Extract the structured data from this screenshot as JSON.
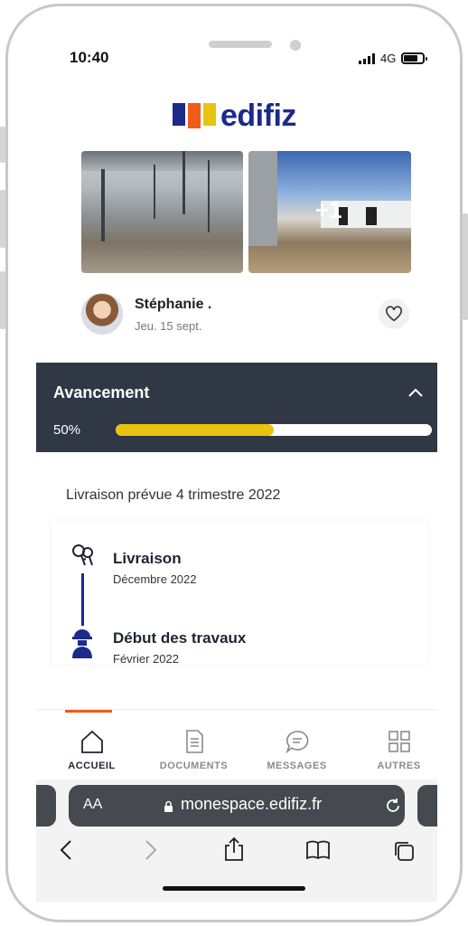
{
  "status_bar": {
    "time": "10:40",
    "network": "4G"
  },
  "brand": {
    "name": "edifiz",
    "colors": [
      "#1c2a8c",
      "#f05a1a",
      "#e8c40f"
    ]
  },
  "photos": {
    "extra_count": "+1"
  },
  "post": {
    "author": "Stéphanie .",
    "date": "Jeu. 15 sept."
  },
  "progress": {
    "title": "Avancement",
    "percent_label": "50%",
    "value": 0.5
  },
  "delivery_text": "Livraison prévue 4 trimestre 2022",
  "timeline": [
    {
      "title": "Livraison",
      "date": "Décembre 2022",
      "icon": "keys-icon"
    },
    {
      "title": "Début des travaux",
      "date": "Février 2022",
      "icon": "worker-icon"
    }
  ],
  "tabs": [
    {
      "label": "ACCUEIL",
      "icon": "home-icon",
      "active": true
    },
    {
      "label": "DOCUMENTS",
      "icon": "document-icon",
      "active": false
    },
    {
      "label": "MESSAGES",
      "icon": "message-icon",
      "active": false
    },
    {
      "label": "AUTRES",
      "icon": "grid-icon",
      "active": false
    }
  ],
  "browser": {
    "text_size": "AA",
    "url": "monespace.edifiz.fr"
  }
}
